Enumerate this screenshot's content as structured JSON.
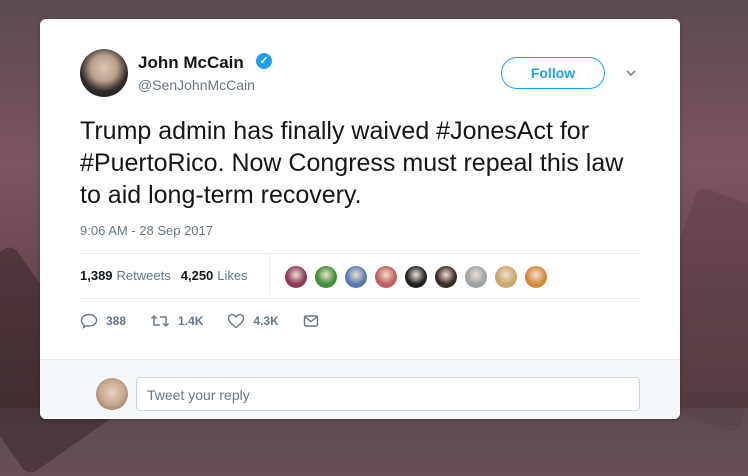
{
  "tweet": {
    "author_name": "John McCain",
    "author_handle": "@SenJohnMcCain",
    "follow_label": "Follow",
    "text": "Trump admin has finally waived #JonesAct for #PuertoRico. Now Congress must repeal this law to aid long-term recovery.",
    "timestamp": "9:06 AM - 28 Sep 2017"
  },
  "stats": {
    "retweets_count": "1,389",
    "retweets_label": "Retweets",
    "likes_count": "4,250",
    "likes_label": "Likes"
  },
  "likers": [
    {
      "color": "#8b3a5a"
    },
    {
      "color": "#3e8e3a"
    },
    {
      "color": "#5a7bb0"
    },
    {
      "color": "#c06060"
    },
    {
      "color": "#222222"
    },
    {
      "color": "#3a2a2a"
    },
    {
      "color": "#9aa3a8"
    },
    {
      "color": "#caa86a"
    },
    {
      "color": "#d08a3a"
    }
  ],
  "actions": {
    "reply_count": "388",
    "retweet_count": "1.4K",
    "like_count": "4.3K"
  },
  "reply": {
    "placeholder": "Tweet your reply"
  },
  "colors": {
    "accent": "#1da1f2",
    "text": "#14171a",
    "muted": "#657786"
  }
}
